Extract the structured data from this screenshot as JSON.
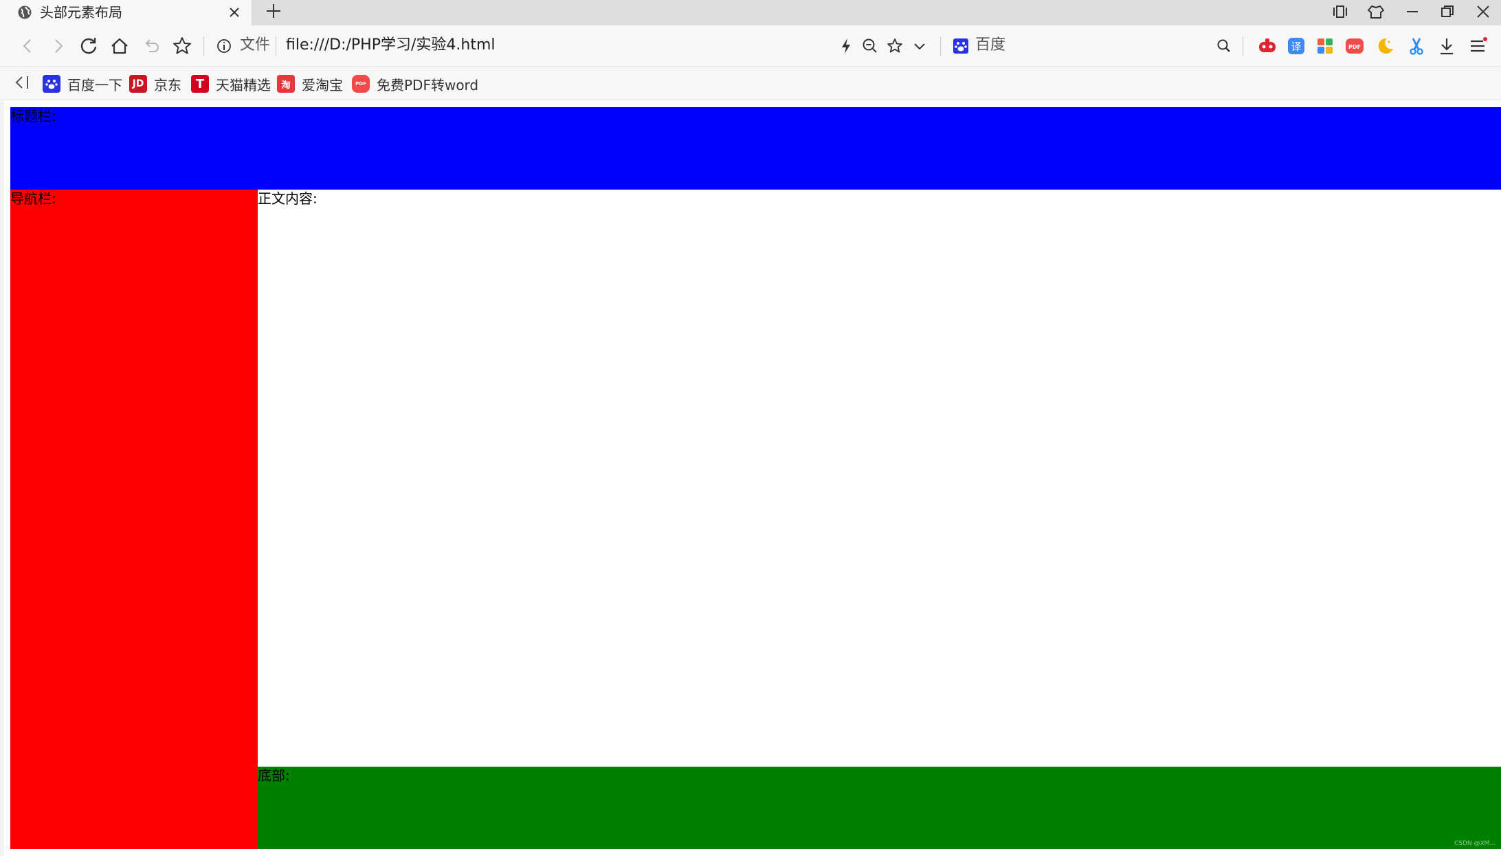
{
  "tab": {
    "title": "头部元素布局"
  },
  "address": {
    "secure_label": "文件",
    "url": "file:///D:/PHP学习/实验4.html",
    "search_engine": "百度"
  },
  "bookmarks": [
    {
      "label": "百度一下",
      "icon": "baidu-paw-icon",
      "color": "#2932e1"
    },
    {
      "label": "京东",
      "icon": "jd-icon",
      "color": "#c91623"
    },
    {
      "label": "天猫精选",
      "icon": "tmall-icon",
      "color": "#d4001f"
    },
    {
      "label": "爱淘宝",
      "icon": "taobao-icon",
      "color": "#e4393c"
    },
    {
      "label": "免费PDF转word",
      "icon": "pdf-icon",
      "color": "#f04a4a"
    }
  ],
  "page": {
    "header_label": "标题栏:",
    "nav_label": "导航栏:",
    "content_label": "正文内容:",
    "footer_label": "底部:",
    "watermark": "CSDN @XM..."
  },
  "colors": {
    "header": "#0000ff",
    "nav": "#ff0000",
    "content": "#ffffff",
    "footer": "#008000"
  }
}
